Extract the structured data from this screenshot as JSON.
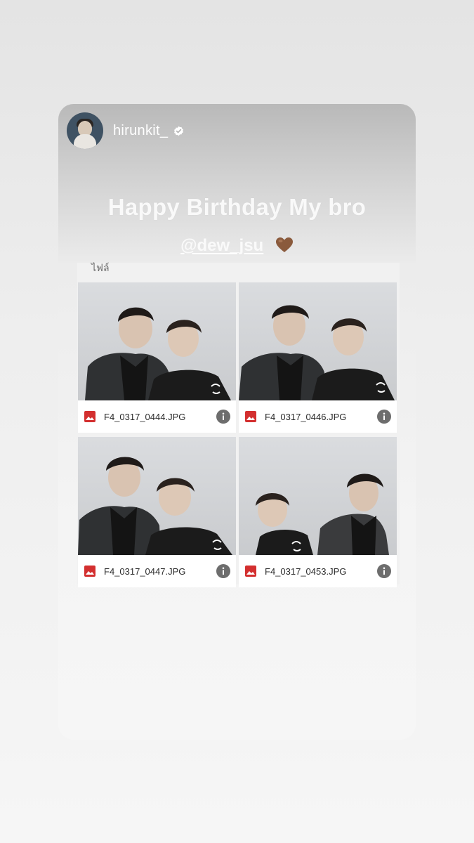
{
  "story": {
    "username": "hirunkit_",
    "headline": "Happy Birthday My bro",
    "mention": "@dew_jsu",
    "heart_emoji": "brown-heart"
  },
  "files": {
    "label": "ไฟล์",
    "items": [
      {
        "name": "F4_0317_0444.JPG"
      },
      {
        "name": "F4_0317_0446.JPG"
      },
      {
        "name": "F4_0317_0447.JPG"
      },
      {
        "name": "F4_0317_0453.JPG"
      }
    ]
  },
  "colors": {
    "file_icon_red": "#d32f2f",
    "info_icon_gray": "#6d6d6d",
    "heart_brown": "#8a5a3c"
  }
}
